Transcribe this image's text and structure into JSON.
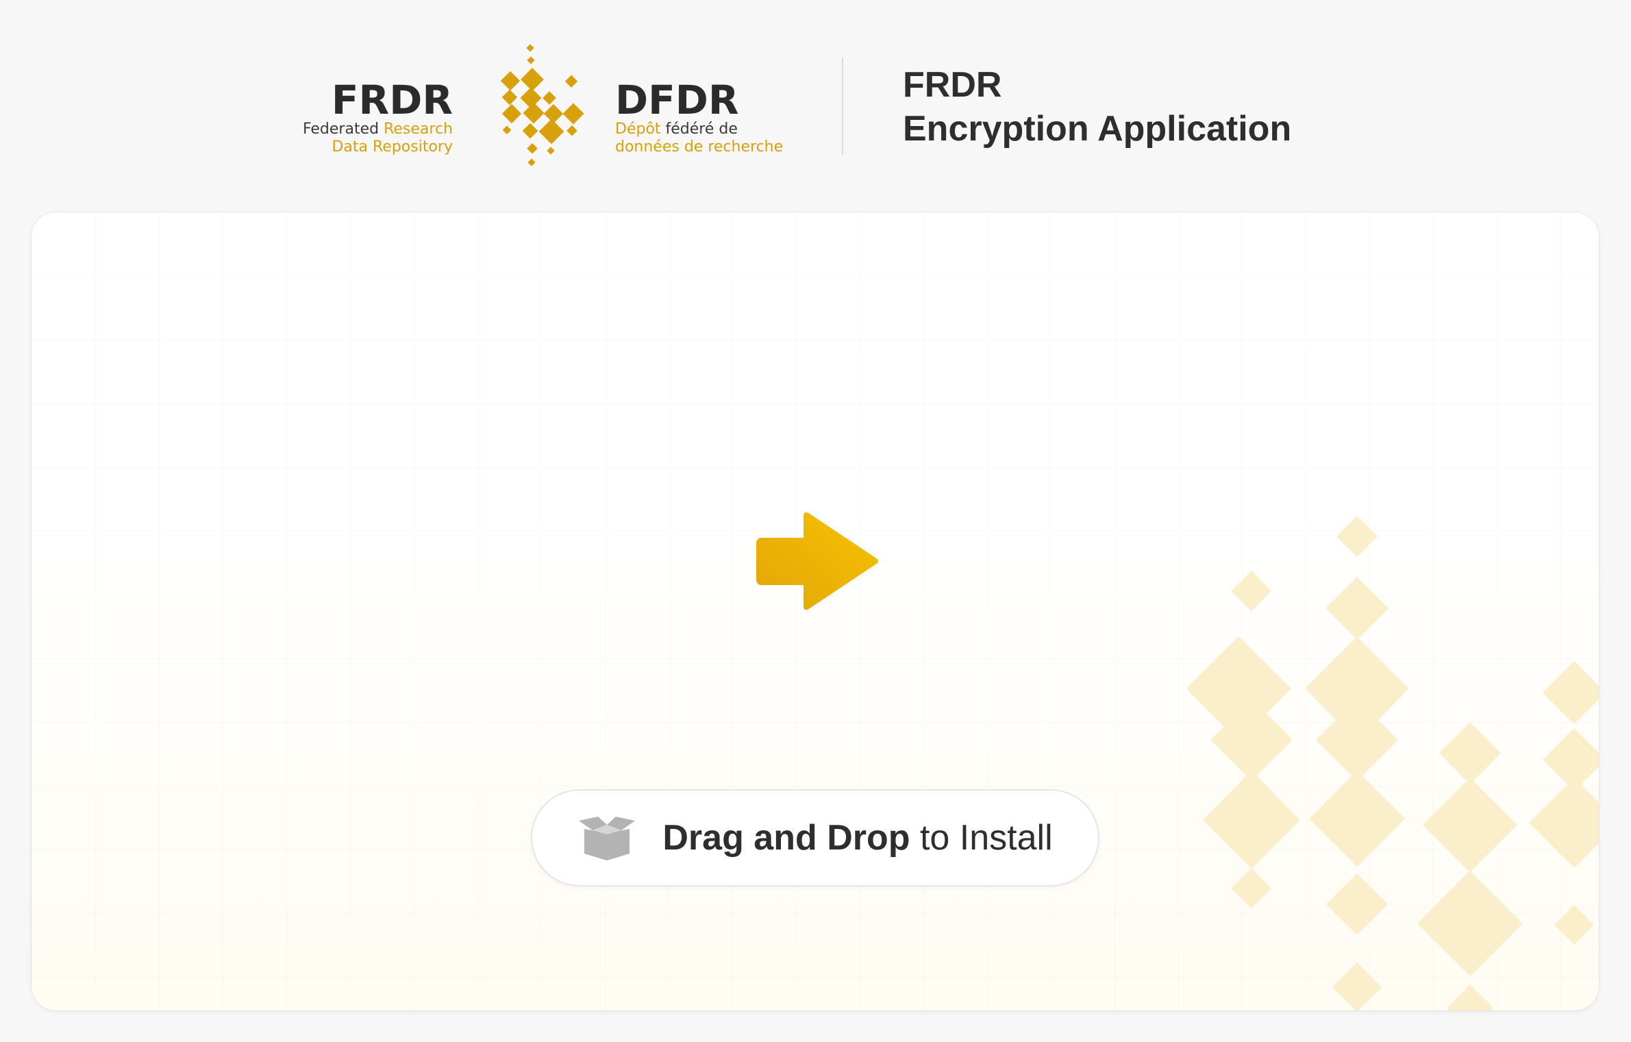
{
  "header": {
    "brand_en": {
      "acronym": "FRDR",
      "line1_plain": "Federated ",
      "line1_accent": "Research",
      "line2": "Data Repository"
    },
    "brand_fr": {
      "acronym": "DFDR",
      "line1_accent": "Dépôt",
      "line1_plain": " fédéré de",
      "line2": "données de recherche"
    },
    "app_title_line1": "FRDR",
    "app_title_line2": "Encryption Application"
  },
  "main": {
    "arrow_icon": "arrow-right-icon",
    "install": {
      "icon": "open-box-icon",
      "strong_text": "Drag and Drop",
      "plain_text": " to Install"
    }
  },
  "colors": {
    "accent_gold": "#d8a10c",
    "arrow_gold_start": "#e3a50a",
    "arrow_gold_end": "#f6c200",
    "pattern_gold": "#fbeecb",
    "text_dark": "#2e2e2e",
    "background": "#f7f7f7"
  }
}
